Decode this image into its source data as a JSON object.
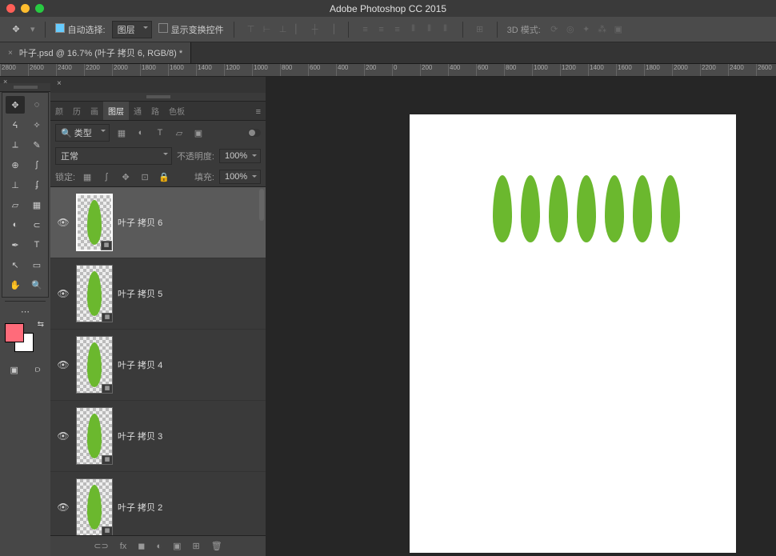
{
  "app_title": "Adobe Photoshop CC 2015",
  "doc_tab": "叶子.psd @ 16.7% (叶子 拷贝 6, RGB/8) *",
  "optbar": {
    "auto_select": "自动选择:",
    "layer_dd": "图层",
    "show_transform": "显示变换控件",
    "mode_3d": "3D 模式:"
  },
  "ruler_ticks": [
    "2800",
    "2600",
    "2400",
    "2200",
    "2000",
    "1800",
    "1600",
    "1400",
    "1200",
    "1000",
    "800",
    "600",
    "400",
    "200",
    "0",
    "200",
    "400",
    "600",
    "800",
    "1000",
    "1200",
    "1400",
    "1600",
    "1800",
    "2000",
    "2200",
    "2400",
    "2600"
  ],
  "panel_tabs": [
    "颜",
    "历",
    "画",
    "图层",
    "通",
    "路",
    "色板"
  ],
  "layer_filter": {
    "kind": "类型"
  },
  "blend": {
    "mode": "正常",
    "opacity_label": "不透明度:",
    "opacity_val": "100%"
  },
  "lock": {
    "label": "锁定:",
    "fill_label": "填充:",
    "fill_val": "100%"
  },
  "layers": [
    {
      "name": "叶子 拷贝 6",
      "selected": true
    },
    {
      "name": "叶子 拷贝 5",
      "selected": false
    },
    {
      "name": "叶子 拷贝 4",
      "selected": false
    },
    {
      "name": "叶子 拷贝 3",
      "selected": false
    },
    {
      "name": "叶子 拷贝 2",
      "selected": false
    }
  ],
  "canvas": {
    "leaf_positions": [
      104,
      139,
      174,
      209,
      244,
      279,
      314
    ]
  }
}
